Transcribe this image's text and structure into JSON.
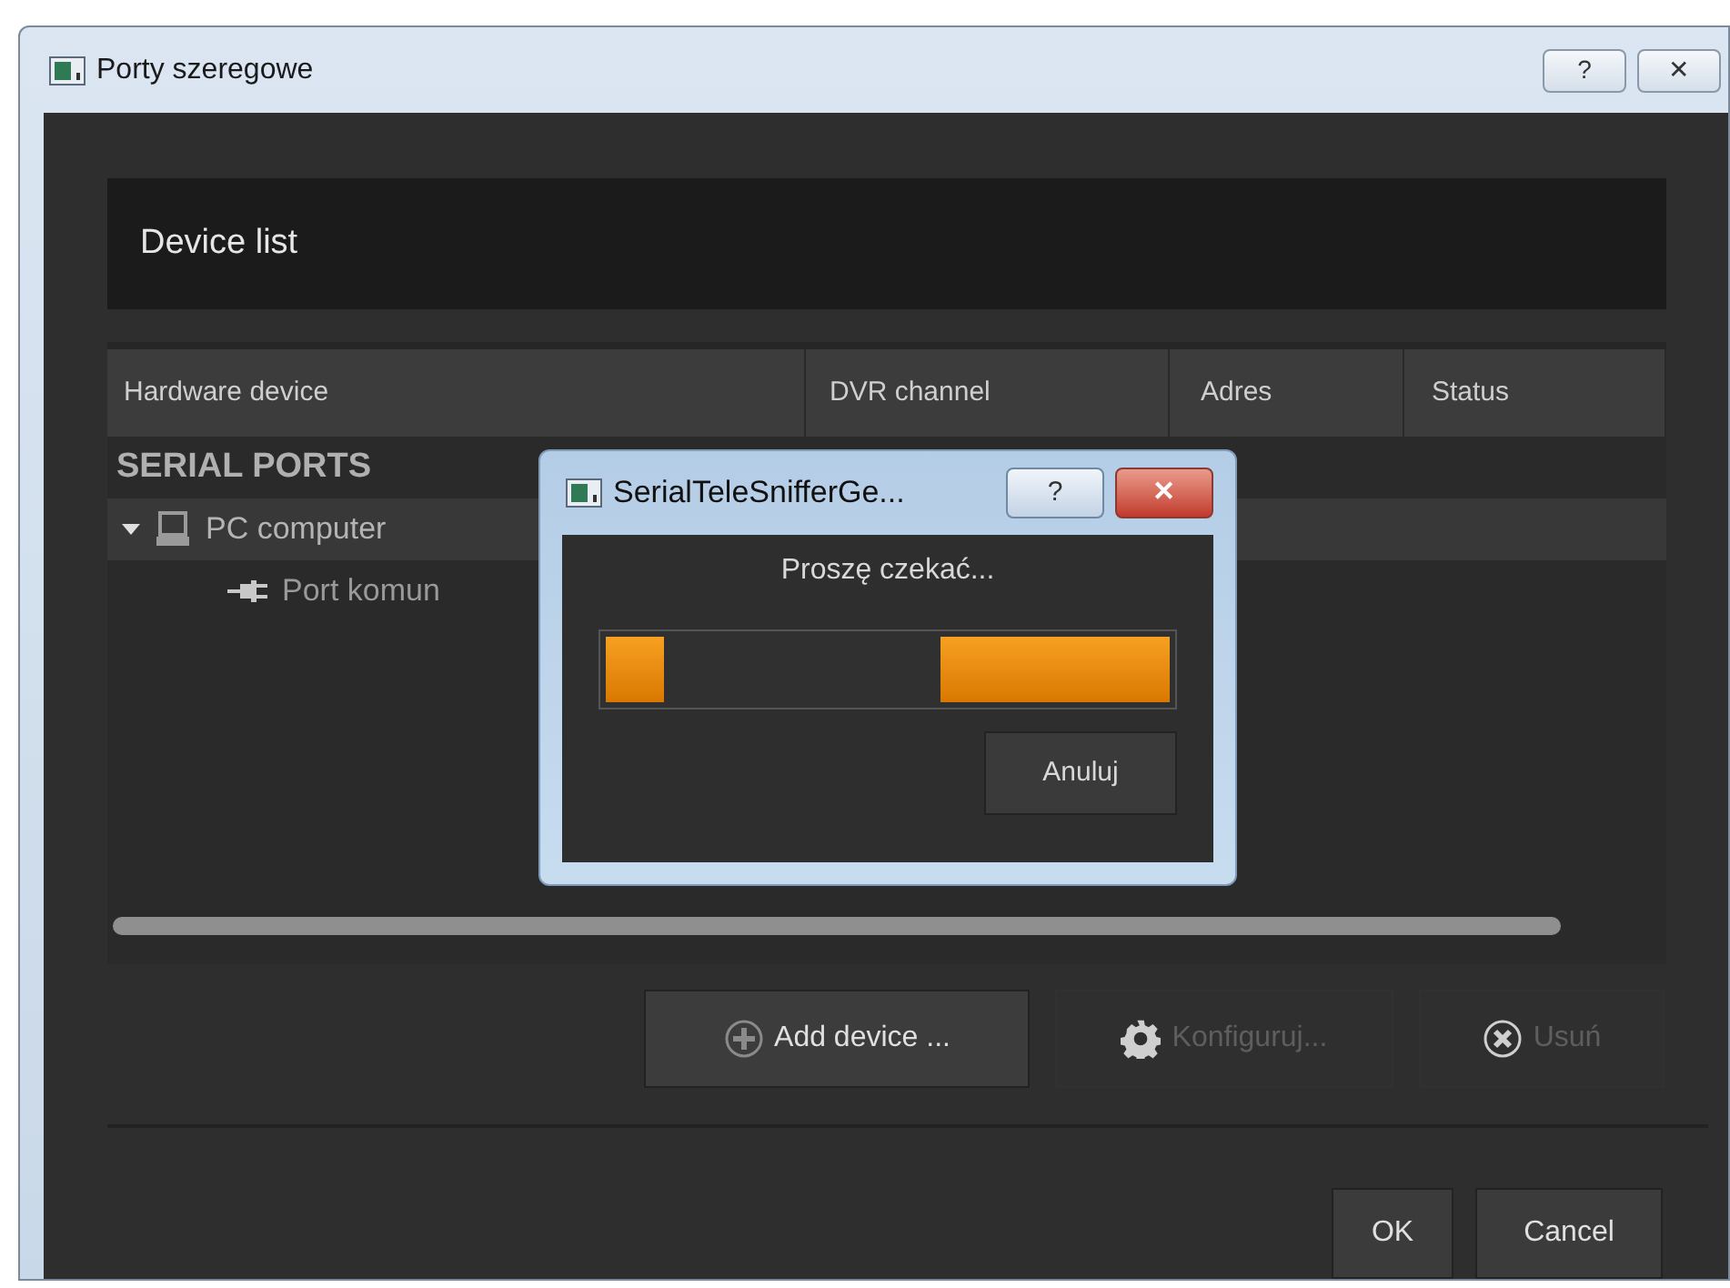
{
  "window": {
    "title": "Porty szeregowe",
    "help": "?",
    "close": "✕"
  },
  "panel_title": "Device list",
  "table": {
    "columns": [
      "Hardware device",
      "DVR channel",
      "Adres",
      "Status"
    ],
    "rows": [
      {
        "kind": "group",
        "label": "SERIAL PORTS"
      },
      {
        "kind": "computer",
        "label": "PC computer",
        "expanded": true,
        "selected": true
      },
      {
        "kind": "port",
        "label": "Port komun",
        "selected": false
      }
    ]
  },
  "actions": [
    {
      "kind": "add",
      "label": "Add device ...",
      "disabled": false
    },
    {
      "kind": "configure",
      "label": "Konfiguruj...",
      "disabled": true
    },
    {
      "kind": "remove",
      "label": "Usuń",
      "disabled": true
    }
  ],
  "buttons": [
    "OK",
    "Cancel"
  ],
  "dialog": {
    "title": "SerialTeleSnifferGe...",
    "help": "?",
    "close": "✕",
    "message": "Proszę czekać...",
    "button": "Anuluj"
  }
}
